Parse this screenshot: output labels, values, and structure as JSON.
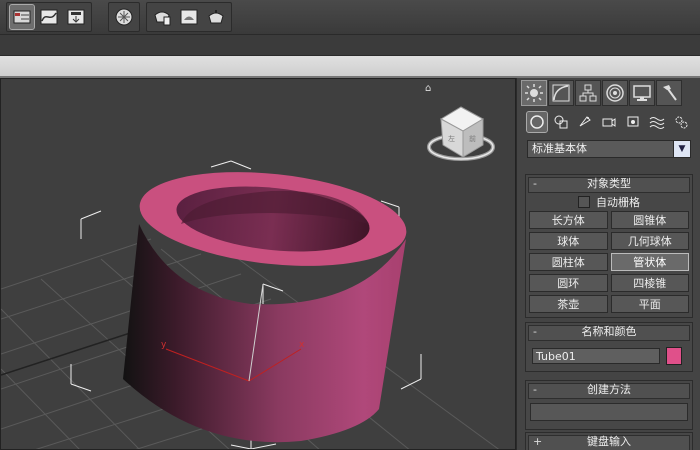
{
  "toolbar": {
    "icons": [
      "scene-explorer-icon",
      "curve-editor-icon",
      "schematic-view-icon",
      "material-editor-icon",
      "render-setup-icon",
      "rendered-frame-icon",
      "render-production-icon"
    ]
  },
  "viewport": {
    "axis_x": "x",
    "axis_y": "y",
    "object_color": "#b8497a"
  },
  "panel": {
    "category_value": "标准基本体",
    "object_type": {
      "header_sign": "-",
      "title": "对象类型",
      "autogrid_label": "自动栅格",
      "buttons": [
        "长方体",
        "圆锥体",
        "球体",
        "几何球体",
        "圆柱体",
        "管状体",
        "圆环",
        "四棱锥",
        "茶壶",
        "平面"
      ],
      "selected": "管状体"
    },
    "name_color": {
      "header_sign": "-",
      "title": "名称和颜色",
      "name_value": "Tube01",
      "color": "#e0508a"
    },
    "creation_method": {
      "header_sign": "-",
      "title": "创建方法"
    },
    "keyboard_entry": {
      "header_sign": "+",
      "title": "键盘输入"
    }
  }
}
